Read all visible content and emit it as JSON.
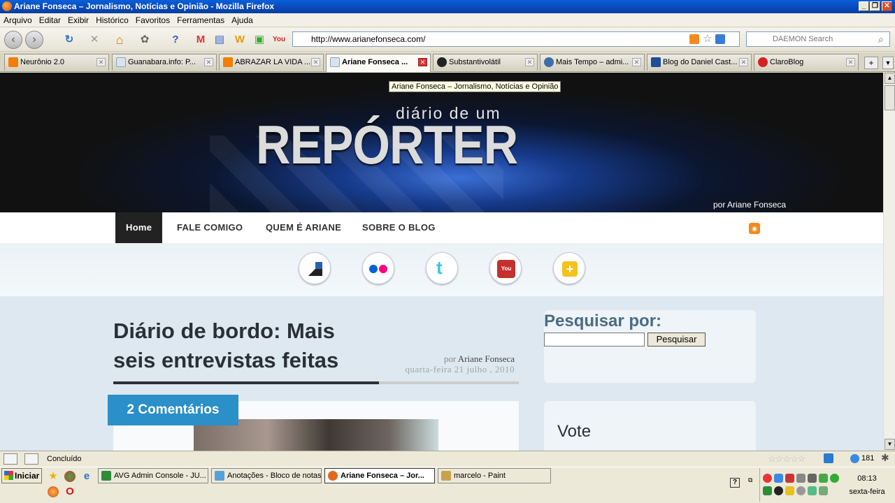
{
  "window": {
    "title": "Ariane Fonseca – Jornalismo, Notícias e Opinião - Mozilla Firefox",
    "min": "_",
    "max": "❐",
    "close": "✕"
  },
  "menu": [
    "Arquivo",
    "Editar",
    "Exibir",
    "Histórico",
    "Favoritos",
    "Ferramentas",
    "Ajuda"
  ],
  "toolbar": {
    "url": "http://www.arianefonseca.com/",
    "search_placeholder": "DAEMON Search",
    "back": "‹",
    "forward": "›",
    "reload": "↻",
    "stop": "✕",
    "home": "⌂"
  },
  "tabs": [
    {
      "label": "Neurônio 2.0",
      "color": "#f57d00"
    },
    {
      "label": "Guanabara.info: P...",
      "color": "#d9e2f0"
    },
    {
      "label": "ABRAZAR LA VIDA ...",
      "color": "#f57d00"
    },
    {
      "label": "Ariane Fonseca ...",
      "color": "#d9e2f0",
      "active": true
    },
    {
      "label": "Substantivolátil",
      "color": "#222"
    },
    {
      "label": "Mais Tempo – admi...",
      "color": "#3c6ea8"
    },
    {
      "label": "Blog do Daniel Cast...",
      "color": "#1d4c9a"
    },
    {
      "label": "ClaroBlog",
      "color": "#d42222"
    }
  ],
  "tab_close": "✕",
  "tooltip": "Ariane Fonseca – Jornalismo, Notícias e Opinião",
  "site": {
    "logo_top": "diário de um",
    "logo_main": "REPÓRTER",
    "byline": "por Ariane Fonseca",
    "nav": [
      "Home",
      "FALE COMIGO",
      "QUEM É ARIANE",
      "SOBRE O BLOG"
    ],
    "rss": "RSS",
    "social": [
      "delicious",
      "flickr",
      "twitter",
      "youtube",
      "add"
    ],
    "post": {
      "title_line1": "Diário de bordo: Mais",
      "title_line2": "seis entrevistas feitas",
      "by_prefix": "por",
      "author": "Ariane Fonseca",
      "date": "quarta-feira 21 julho , 2010",
      "comments": "2 Comentários"
    },
    "sidebar": {
      "search_label": "Pesquisar por:",
      "search_button": "Pesquisar",
      "vote_label": "Vote"
    }
  },
  "status": {
    "text": "Concluído",
    "stars": "☆☆☆☆☆",
    "count": "181"
  },
  "taskbar": {
    "start": "Iniciar",
    "buttons": [
      {
        "label": "AVG Admin Console - JU...",
        "color": "#2e8b3a"
      },
      {
        "label": "Anotações - Bloco de notas",
        "color": "#5aa0d8"
      },
      {
        "label": "Ariane Fonseca – Jor...",
        "color": "#e2661d",
        "active": true
      },
      {
        "label": "marcelo - Paint",
        "color": "#c9a24a"
      }
    ],
    "time": "08:13",
    "day": "sexta-feira"
  },
  "colors": {
    "accent": "#2b8fc8",
    "brand_dark": "#2a3038",
    "titlebar": "#0848b8"
  }
}
